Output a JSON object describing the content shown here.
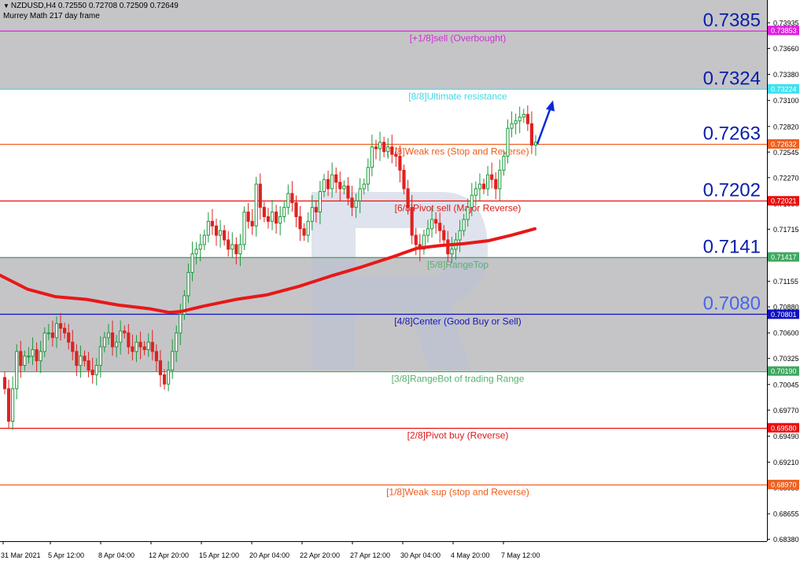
{
  "header": {
    "symbol_line": "NZDUSD,H4  0.72550 0.72708 0.72509 0.72649",
    "indicator_line": "Murrey Math 217 day frame",
    "caret": "▼"
  },
  "colors": {
    "shade": "#c5c5c8",
    "candle_up": "#1a9a3a",
    "candle_down": "#e02020",
    "ma": "#e81818",
    "arrow": "#0a2ad8",
    "axis": "#000000"
  },
  "chart_data": {
    "type": "candlestick",
    "ylim": [
      0.6836,
      0.7418
    ],
    "y_ticks": [
      "0.73935",
      "0.73660",
      "0.73380",
      "0.73100",
      "0.72820",
      "0.72545",
      "0.72270",
      "0.71990",
      "0.71715",
      "0.71435",
      "0.71155",
      "0.70880",
      "0.70600",
      "0.70325",
      "0.70045",
      "0.69770",
      "0.69490",
      "0.69210",
      "0.68935",
      "0.68655",
      "0.68380"
    ],
    "x_ticks": [
      "31 Mar 2021",
      "5 Apr 12:00",
      "8 Apr 04:00",
      "12 Apr 20:00",
      "15 Apr 12:00",
      "20 Apr 04:00",
      "22 Apr 20:00",
      "27 Apr 12:00",
      "30 Apr 04:00",
      "4 May 20:00",
      "7 May 12:00"
    ],
    "levels": [
      {
        "value": 0.73853,
        "label": "[+1/8]sell (Overbought)",
        "big": "0.7385",
        "tag": "0.73853",
        "color": "#e020e0",
        "label_color": "#d030d0",
        "tag_bg": "#e020e0",
        "big_color": "#0a1ea8"
      },
      {
        "value": 0.73224,
        "label": "[8/8]Ultimate resistance",
        "big": "0.7324",
        "tag": "0.73224",
        "color": "#40e0f0",
        "label_color": "#40d8e8",
        "tag_bg": "#40e0f0",
        "big_color": "#0a1ea8"
      },
      {
        "value": 0.72632,
        "label": "[7/8]Weak res (Stop and Reverse)",
        "big": "0.7263",
        "tag": "0.72632",
        "color": "#f06020",
        "label_color": "#f05a18",
        "tag_bg": "#f06020",
        "big_color": "#0a1ea8"
      },
      {
        "value": 0.72021,
        "label": "[6/8]Pivot sell (Major Reverse)",
        "big": "0.7202",
        "tag": "0.72021",
        "color": "#e81010",
        "label_color": "#e01818",
        "tag_bg": "#e81010",
        "big_color": "#0a1ea8"
      },
      {
        "value": 0.71417,
        "label": "[5/8]RangeTop",
        "big": "0.7141",
        "tag": "0.71417",
        "color": "#40a860",
        "label_color": "#58b070",
        "tag_bg": "#40a860",
        "big_color": "#0a1ea8"
      },
      {
        "value": 0.70801,
        "label": "[4/8]Center (Good Buy or Sell)",
        "big": "0.7080",
        "tag": "0.70801",
        "color": "#1010c0",
        "label_color": "#1414b8",
        "tag_bg": "#1010c0",
        "big_color": "#4466e8"
      },
      {
        "value": 0.7019,
        "label": "[3/8]RangeBot of trading Range",
        "big": "",
        "tag": "0.70190",
        "color": "#40a860",
        "label_color": "#58b070",
        "tag_bg": "#40a860",
        "big_color": "#0a1ea8"
      },
      {
        "value": 0.6958,
        "label": "[2/8]Pivot buy (Reverse)",
        "big": "",
        "tag": "0.69580",
        "color": "#e81010",
        "label_color": "#e01818",
        "tag_bg": "#e81010",
        "big_color": "#0a1ea8"
      },
      {
        "value": 0.6897,
        "label": "[1/8]Weak sup (stop and Reverse)",
        "big": "",
        "tag": "0.68970",
        "color": "#f06020",
        "label_color": "#f05a18",
        "tag_bg": "#f06020",
        "big_color": "#0a1ea8"
      }
    ],
    "shaded_zones": [
      [
        0.73224,
        0.7418
      ],
      [
        0.7019,
        0.71417
      ]
    ],
    "closes": [
      0.7,
      0.6965,
      0.7,
      0.704,
      0.7025,
      0.7035,
      0.7035,
      0.7042,
      0.703,
      0.704,
      0.706,
      0.706,
      0.7055,
      0.707,
      0.7065,
      0.706,
      0.705,
      0.704,
      0.7025,
      0.7035,
      0.703,
      0.702,
      0.7015,
      0.7025,
      0.7045,
      0.7055,
      0.706,
      0.7045,
      0.705,
      0.7062,
      0.706,
      0.7045,
      0.704,
      0.705,
      0.7045,
      0.7042,
      0.705,
      0.704,
      0.703,
      0.7015,
      0.7005,
      0.702,
      0.704,
      0.706,
      0.708,
      0.71,
      0.7125,
      0.7145,
      0.715,
      0.7155,
      0.7165,
      0.718,
      0.7175,
      0.7165,
      0.717,
      0.716,
      0.715,
      0.7155,
      0.7145,
      0.7155,
      0.719,
      0.718,
      0.7175,
      0.722,
      0.7195,
      0.7185,
      0.718,
      0.719,
      0.7178,
      0.7185,
      0.7195,
      0.721,
      0.72,
      0.7185,
      0.7172,
      0.7165,
      0.718,
      0.7195,
      0.719,
      0.7212,
      0.7225,
      0.7215,
      0.723,
      0.7222,
      0.7215,
      0.7218,
      0.7205,
      0.7195,
      0.7202,
      0.7215,
      0.722,
      0.7238,
      0.726,
      0.7258,
      0.7265,
      0.7255,
      0.726,
      0.7252,
      0.725,
      0.7235,
      0.7215,
      0.7195,
      0.7165,
      0.7155,
      0.715,
      0.7165,
      0.7172,
      0.7182,
      0.7178,
      0.717,
      0.716,
      0.7145,
      0.715,
      0.716,
      0.717,
      0.7182,
      0.7195,
      0.7208,
      0.7215,
      0.722,
      0.7215,
      0.723,
      0.7225,
      0.7215,
      0.7235,
      0.725,
      0.728,
      0.7285,
      0.7288,
      0.7292,
      0.7295,
      0.7285,
      0.7262,
      0.7265
    ],
    "ma_points": [
      [
        0,
        0.7122
      ],
      [
        35,
        0.7107
      ],
      [
        70,
        0.7099
      ],
      [
        110,
        0.7096
      ],
      [
        150,
        0.709
      ],
      [
        190,
        0.7086
      ],
      [
        215,
        0.7082
      ],
      [
        230,
        0.7083
      ],
      [
        260,
        0.7089
      ],
      [
        300,
        0.7096
      ],
      [
        340,
        0.7101
      ],
      [
        380,
        0.711
      ],
      [
        420,
        0.7121
      ],
      [
        460,
        0.7131
      ],
      [
        500,
        0.7142
      ],
      [
        530,
        0.7151
      ],
      [
        560,
        0.7154
      ],
      [
        590,
        0.7156
      ],
      [
        620,
        0.7159
      ],
      [
        650,
        0.7165
      ],
      [
        680,
        0.7172
      ]
    ],
    "forecast_arrow": {
      "from": [
        0.7263,
        683
      ],
      "to": [
        0.731,
        703
      ]
    }
  }
}
